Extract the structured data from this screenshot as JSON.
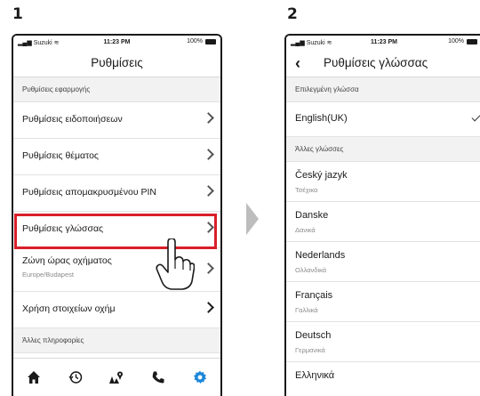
{
  "steps": [
    "1",
    "2"
  ],
  "status_bar": {
    "carrier": "Suzuki",
    "time": "11:23 PM",
    "battery": "100%"
  },
  "screen1": {
    "title": "Ρυθμίσεις",
    "section_app": "Ρυθμίσεις εφαρμογής",
    "items": [
      {
        "label": "Ρυθμίσεις ειδοποιήσεων"
      },
      {
        "label": "Ρυθμίσεις θέματος"
      },
      {
        "label": "Ρυθμίσεις απομακρυσμένου PIN"
      },
      {
        "label": "Ρυθμίσεις γλώσσας"
      },
      {
        "label": "Ζώνη ώρας οχήματος",
        "sub": "Europe/Budapest"
      },
      {
        "label": "Χρήση στοιχείων οχήμ"
      }
    ],
    "section_other": "Άλλες πληροφορίες",
    "tabs": [
      "home-icon",
      "history-icon",
      "map-icon",
      "phone-icon",
      "settings-icon"
    ],
    "active_tab_color": "#1e88d9"
  },
  "screen2": {
    "title": "Ρυθμίσεις γλώσσας",
    "section_selected": "Επιλεγμένη γλώσσα",
    "selected_language": "English(UK)",
    "section_other": "Άλλες γλώσσες",
    "languages": [
      {
        "name": "Český jazyk",
        "native": "Τσέχικα"
      },
      {
        "name": "Danske",
        "native": "Δανικά"
      },
      {
        "name": "Nederlands",
        "native": "Ολλανδικά"
      },
      {
        "name": "Français",
        "native": "Γαλλικά"
      },
      {
        "name": "Deutsch",
        "native": "Γερμανικά"
      },
      {
        "name": "Ελληνικά"
      }
    ]
  },
  "highlight_color": "#d81f2a"
}
